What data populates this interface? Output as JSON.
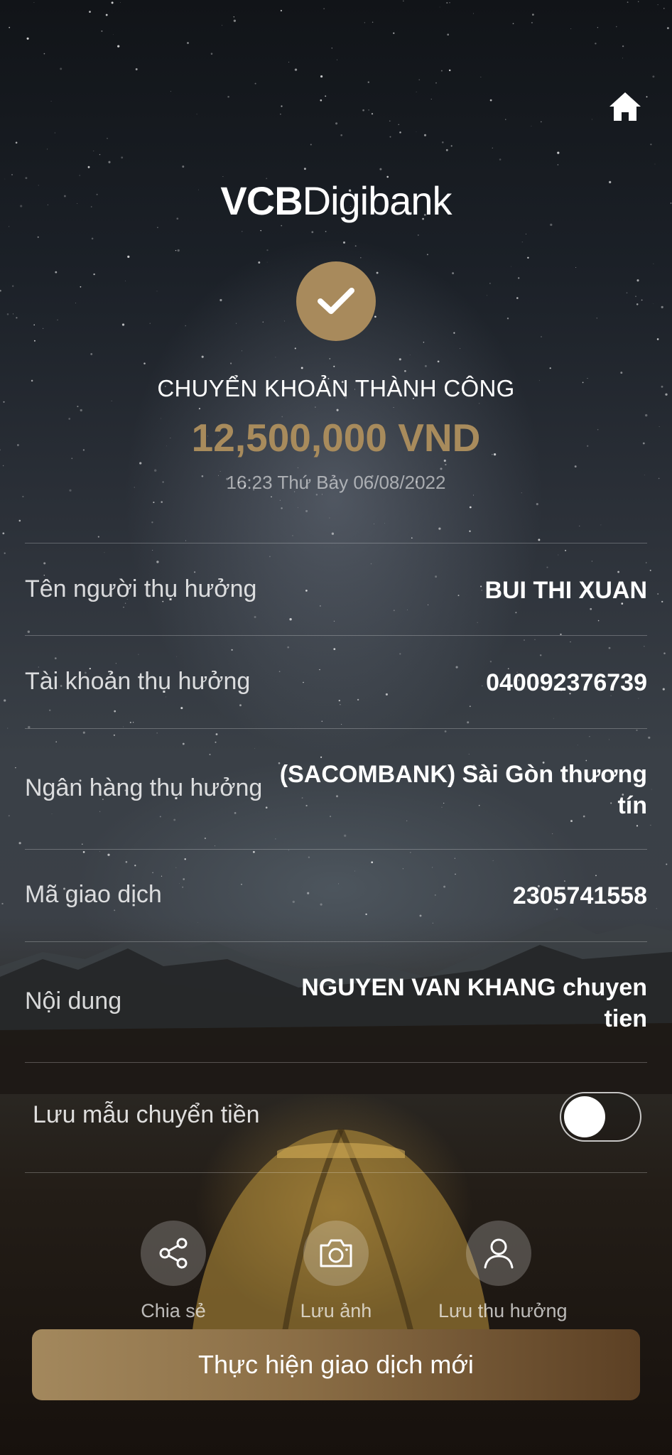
{
  "brand": {
    "part1": "VCB",
    "part2": "Digibank"
  },
  "status": {
    "title": "CHUYỂN KHOẢN THÀNH CÔNG",
    "amount": "12,500,000 VND",
    "datetime": "16:23 Thứ Bảy 06/08/2022"
  },
  "details": [
    {
      "label": "Tên người thụ hưởng",
      "value": "BUI THI XUAN"
    },
    {
      "label": "Tài khoản thụ hưởng",
      "value": "040092376739"
    },
    {
      "label": "Ngân hàng thụ hưởng",
      "value": "(SACOMBANK) Sài Gòn thương tín"
    },
    {
      "label": "Mã giao dịch",
      "value": "2305741558"
    },
    {
      "label": "Nội dung",
      "value": "NGUYEN VAN KHANG chuyen tien"
    }
  ],
  "save_template": {
    "label": "Lưu mẫu chuyển tiền",
    "enabled": false
  },
  "actions": [
    {
      "label": "Chia sẻ",
      "icon": "share-icon"
    },
    {
      "label": "Lưu ảnh",
      "icon": "camera-icon"
    },
    {
      "label": "Lưu thu hưởng",
      "icon": "user-icon"
    }
  ],
  "primary_button": "Thực hiện giao dịch mới",
  "colors": {
    "gold": "#a88b5c",
    "button_start": "#a3885d",
    "button_end": "#5c4024"
  }
}
